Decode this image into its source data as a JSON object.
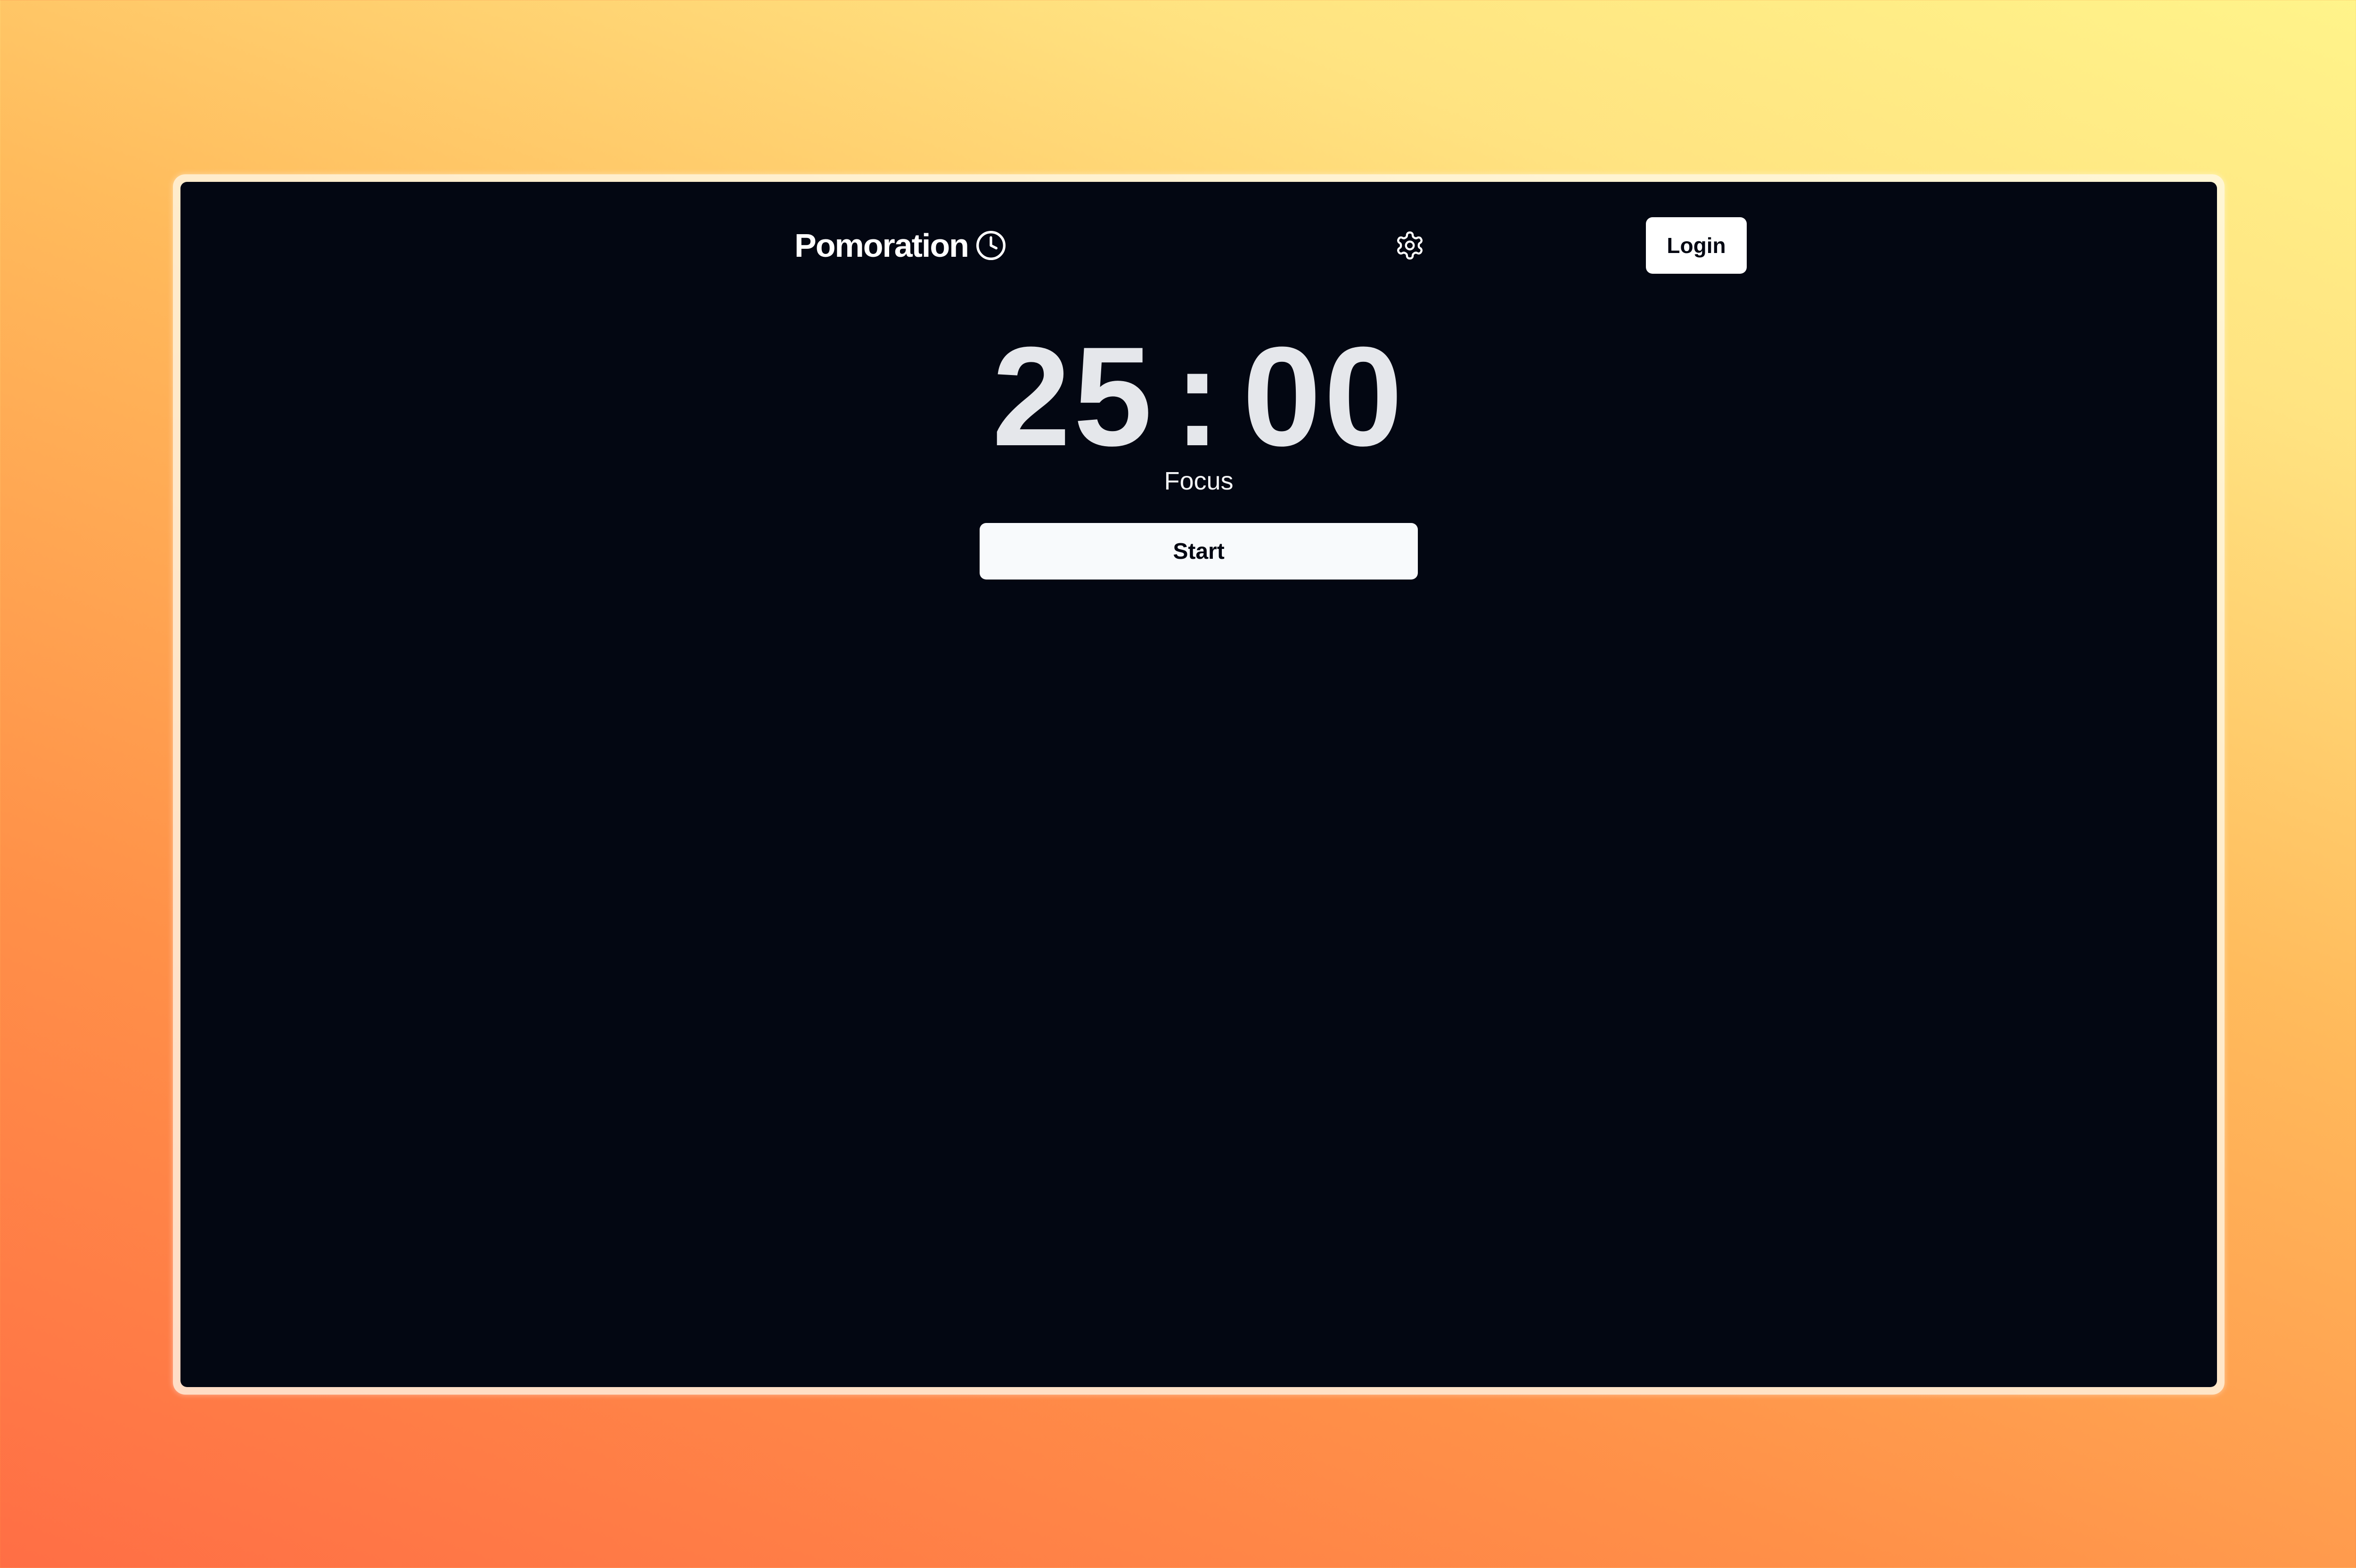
{
  "app": {
    "name": "Pomoration",
    "brand_icon": "clock-icon"
  },
  "header": {
    "settings_icon": "gear-icon",
    "login_label": "Login"
  },
  "timer": {
    "minutes": "25",
    "separator": ":",
    "seconds": "00",
    "mode": "Focus",
    "start_label": "Start"
  },
  "colors": {
    "app_background": "#030712",
    "primary_text": "#ffffff",
    "timer_text": "#e5e7eb",
    "button_background": "#ffffff",
    "button_text": "#030712",
    "backdrop_start": "#ff6e45",
    "backdrop_end": "#fff48a"
  }
}
